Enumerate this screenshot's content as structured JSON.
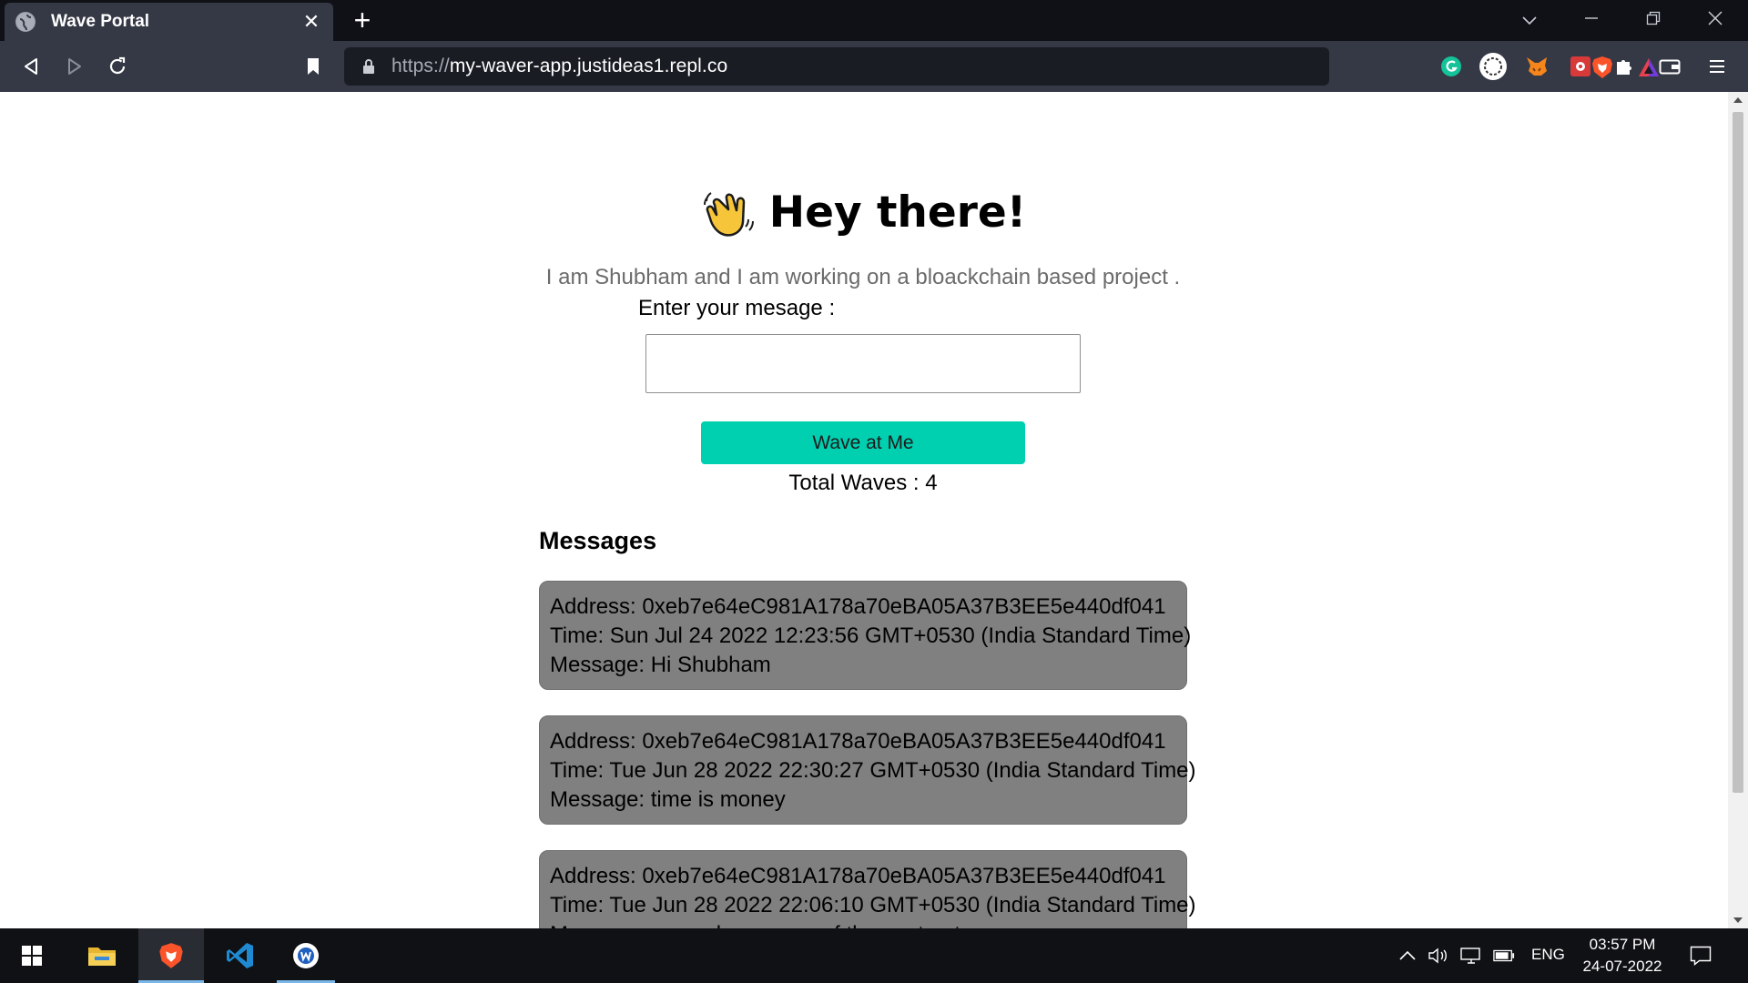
{
  "browser": {
    "tab_title": "Wave Portal",
    "tab_close": "✕",
    "new_tab": "+",
    "url_scheme": "https://",
    "url_host": "my-waver-app.justideas1.repl.co",
    "window_controls": [
      "chevron-down-icon",
      "minimize-icon",
      "restore-icon",
      "close-icon"
    ],
    "extensions": [
      "grammarly-icon",
      "circle-extension-icon",
      "metamask-icon",
      "bug-extension-icon",
      "puzzle-extensions-icon",
      "wallet-icon",
      "menu-icon"
    ]
  },
  "page": {
    "emoji": "waving-hand-icon",
    "heading": "Hey there!",
    "bio": "I am Shubham and I am working on a bloackchain based project .",
    "input_label": "Enter your mesage :",
    "input_value": "",
    "wave_button": "Wave at Me",
    "total_waves": "Total Waves : 4",
    "messages_title": "Messages",
    "messages": [
      {
        "address": "Address: 0xeb7e64eC981A178a70eBA05A37B3EE5e440df041",
        "time": "Time: Sun Jul 24 2022 12:23:56 GMT+0530 (India Standard Time)",
        "message": "Message: Hi Shubham"
      },
      {
        "address": "Address: 0xeb7e64eC981A178a70eBA05A37B3EE5e440df041",
        "time": "Time: Tue Jun 28 2022 22:30:27 GMT+0530 (India Standard Time)",
        "message": "Message: time is money"
      },
      {
        "address": "Address: 0xeb7e64eC981A178a70eBA05A37B3EE5e440df041",
        "time": "Time: Tue Jun 28 2022 22:06:10 GMT+0530 (India Standard Time)",
        "message": "Message: second message of the contract"
      }
    ]
  },
  "taskbar": {
    "apps": [
      "windows-start-icon",
      "file-explorer-icon",
      "brave-browser-icon",
      "vscode-icon",
      "wave-app-icon"
    ],
    "language": "ENG",
    "time": "03:57 PM",
    "date": "24-07-2022"
  },
  "colors": {
    "button": "#00cfb0",
    "card": "#808080",
    "chrome_bg": "#353945",
    "tabstrip_bg": "#0f1117"
  }
}
